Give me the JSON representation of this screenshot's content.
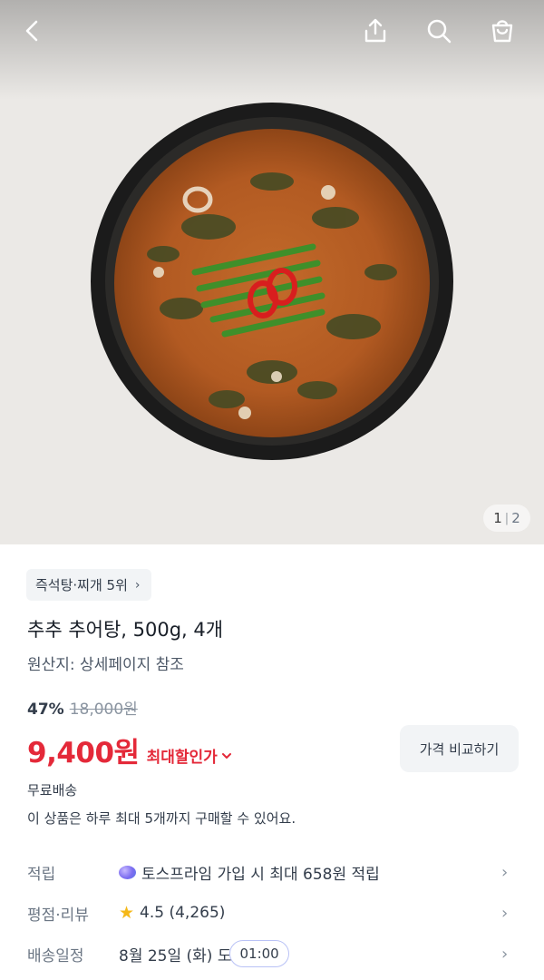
{
  "header": {
    "back_icon": "chevron-left-icon",
    "share_icon": "share-icon",
    "search_icon": "search-icon",
    "cart_icon": "shopping-bag-icon"
  },
  "gallery": {
    "current": "1",
    "separator": "|",
    "total": "2"
  },
  "product": {
    "rank_label": "즉석탕·찌개 5위",
    "rank_chevron": "›",
    "title": "추추 추어탕, 500g, 4개",
    "origin": "원산지: 상세페이지 참조",
    "discount_rate": "47%",
    "original_price": "18,000원",
    "price": "9,400원",
    "max_discount_label": "최대할인가",
    "max_discount_chevron": "⌄",
    "compare_button": "가격 비교하기",
    "shipping": "무료배송",
    "purchase_limit": "이 상품은 하루 최대 5개까지 구매할 수 있어요."
  },
  "rows": [
    {
      "label": "적립",
      "value": "토스프라임 가입 시 최대 658원 적립",
      "icon": "toss-prime-orb-icon",
      "arrow": "›"
    },
    {
      "label": "평점·리뷰",
      "value": "4.5 (4,265)",
      "icon": "star-icon",
      "star": "★",
      "arrow": "›"
    },
    {
      "label": "배송일정",
      "value": "8월 25일 (화) 도",
      "badge": "01:00",
      "arrow": "›"
    }
  ],
  "colors": {
    "price_red": "#e42939",
    "text_primary": "#191f28",
    "text_secondary": "#6b7684",
    "chip_bg": "#f2f4f6",
    "star": "#f5b818"
  }
}
